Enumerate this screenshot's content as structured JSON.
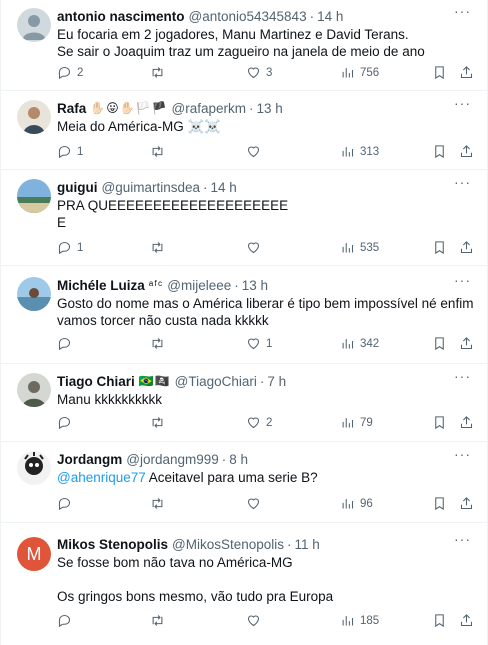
{
  "tweets": [
    {
      "name": "antonio nascimento",
      "handle": "@antonio54345843",
      "time": "14 h",
      "emoji": "",
      "text": "Eu focaria em 2 jogadores, Manu Martinez e David Terans.\nSe sair o Joaquim traz um zagueiro na janela de meio de ano",
      "mention": "",
      "replies": "2",
      "retweets": "",
      "likes": "3",
      "views": "756",
      "avatar": "default-avatar"
    },
    {
      "name": "Rafa",
      "handle": "@rafaperkm",
      "time": "13 h",
      "emoji": "✋🏻😛✋🏻🏳️🏴",
      "text": "Meia do América-MG ☠️☠️",
      "mention": "",
      "replies": "1",
      "retweets": "",
      "likes": "",
      "views": "313",
      "avatar": "photo-avatar"
    },
    {
      "name": "guigui",
      "handle": "@guimartinsdea",
      "time": "14 h",
      "emoji": "",
      "text": "PRA QUEEEEEEEEEEEEEEEEEEEE\nE",
      "mention": "",
      "replies": "1",
      "retweets": "",
      "likes": "",
      "views": "535",
      "avatar": "landscape-avatar"
    },
    {
      "name": "Michéle Luiza",
      "handle": "@mijeleee",
      "time": "13 h",
      "emoji": "ᵃᶠᶜ",
      "text": "Gosto do nome mas o América liberar é tipo bem impossível né enfim\nvamos torcer não custa nada kkkkk",
      "mention": "",
      "replies": "",
      "retweets": "",
      "likes": "1",
      "views": "342",
      "avatar": "beach-avatar"
    },
    {
      "name": "Tiago Chiari",
      "handle": "@TiagoChiari",
      "time": "7 h",
      "emoji": "🇧🇷🏴‍☠️",
      "text": "Manu kkkkkkkkkk",
      "mention": "",
      "replies": "",
      "retweets": "",
      "likes": "2",
      "views": "79",
      "avatar": "photo-avatar"
    },
    {
      "name": "Jordangm",
      "handle": "@jordangm999",
      "time": "8 h",
      "emoji": "",
      "text": " Aceitavel para uma serie B?",
      "mention": "@ahenrique77",
      "replies": "",
      "retweets": "",
      "likes": "",
      "views": "96",
      "avatar": "drawing-avatar"
    },
    {
      "name": "Mikos Stenopolis",
      "handle": "@MikosStenopolis",
      "time": "11 h",
      "emoji": "",
      "text": "Se fosse bom não tava no América-MG\n\nOs gringos bons mesmo, vão tudo pra Europa",
      "mention": "",
      "replies": "",
      "retweets": "",
      "likes": "",
      "views": "185",
      "avatar": "M"
    }
  ],
  "ui": {
    "more": "···",
    "dot": "·"
  },
  "colors": {
    "text": "#0f1419",
    "secondary": "#536471",
    "link": "#1d9bf0",
    "border": "#eff3f4"
  }
}
